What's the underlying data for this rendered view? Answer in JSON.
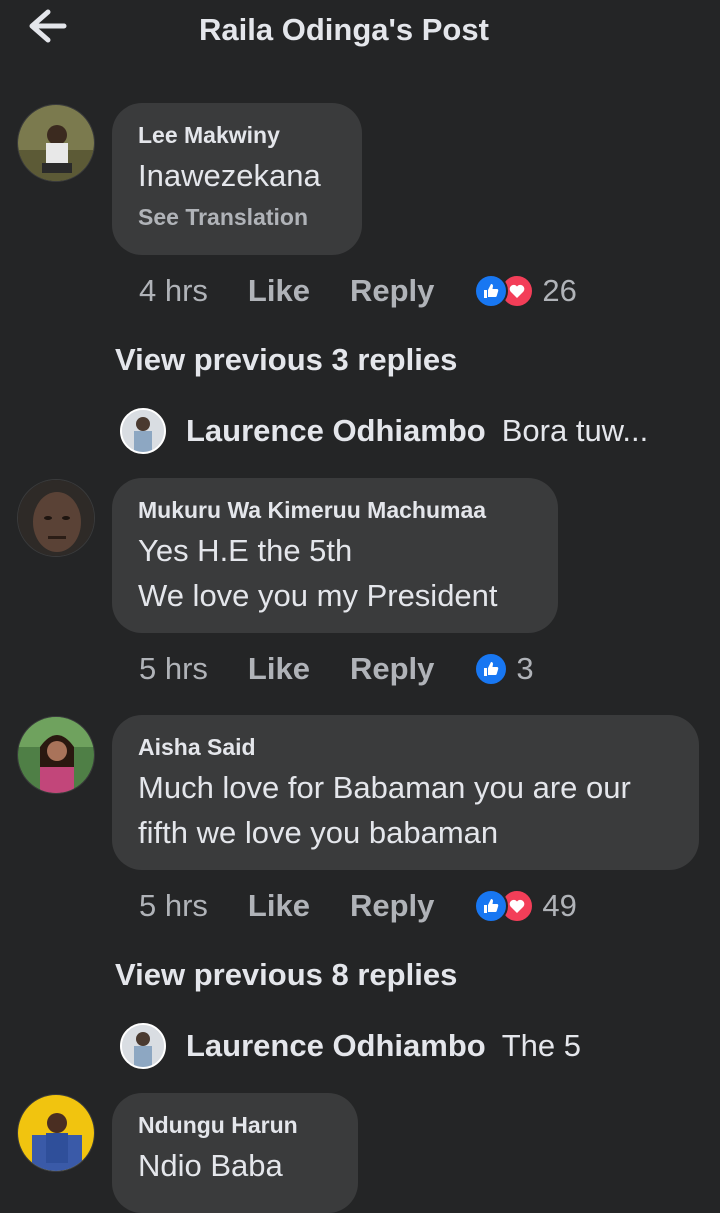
{
  "header": {
    "title": "Raila Odinga's Post",
    "back_icon": "arrow-left-icon"
  },
  "comments": [
    {
      "author": "Lee Makwiny",
      "text": "Inawezekana",
      "see_translation": "See Translation",
      "time": "4 hrs",
      "like_label": "Like",
      "reply_label": "Reply",
      "reactions": [
        "like",
        "love"
      ],
      "reaction_count": "26"
    },
    {
      "author": "Mukuru Wa Kimeruu Machumaa",
      "text": "Yes H.E the 5th\nWe love you my President",
      "time": "5 hrs",
      "like_label": "Like",
      "reply_label": "Reply",
      "reactions": [
        "like"
      ],
      "reaction_count": "3"
    },
    {
      "author": "Aisha Said",
      "text": "Much love for Babaman you are our\nfifth we love you babaman",
      "time": "5 hrs",
      "like_label": "Like",
      "reply_label": "Reply",
      "reactions": [
        "like",
        "love"
      ],
      "reaction_count": "49"
    },
    {
      "author": "Ndungu Harun",
      "text": "Ndio Baba"
    }
  ],
  "reply_threads": [
    {
      "view_previous": "View previous 3 replies",
      "author": "Laurence Odhiambo",
      "preview": "Bora tuw..."
    },
    {
      "view_previous": "View previous 8 replies",
      "author": "Laurence Odhiambo",
      "preview": "The 5"
    }
  ],
  "colors": {
    "background": "#242526",
    "bubble": "#3a3b3c",
    "like_blue": "#1877f2",
    "love_red": "#f33e58"
  }
}
